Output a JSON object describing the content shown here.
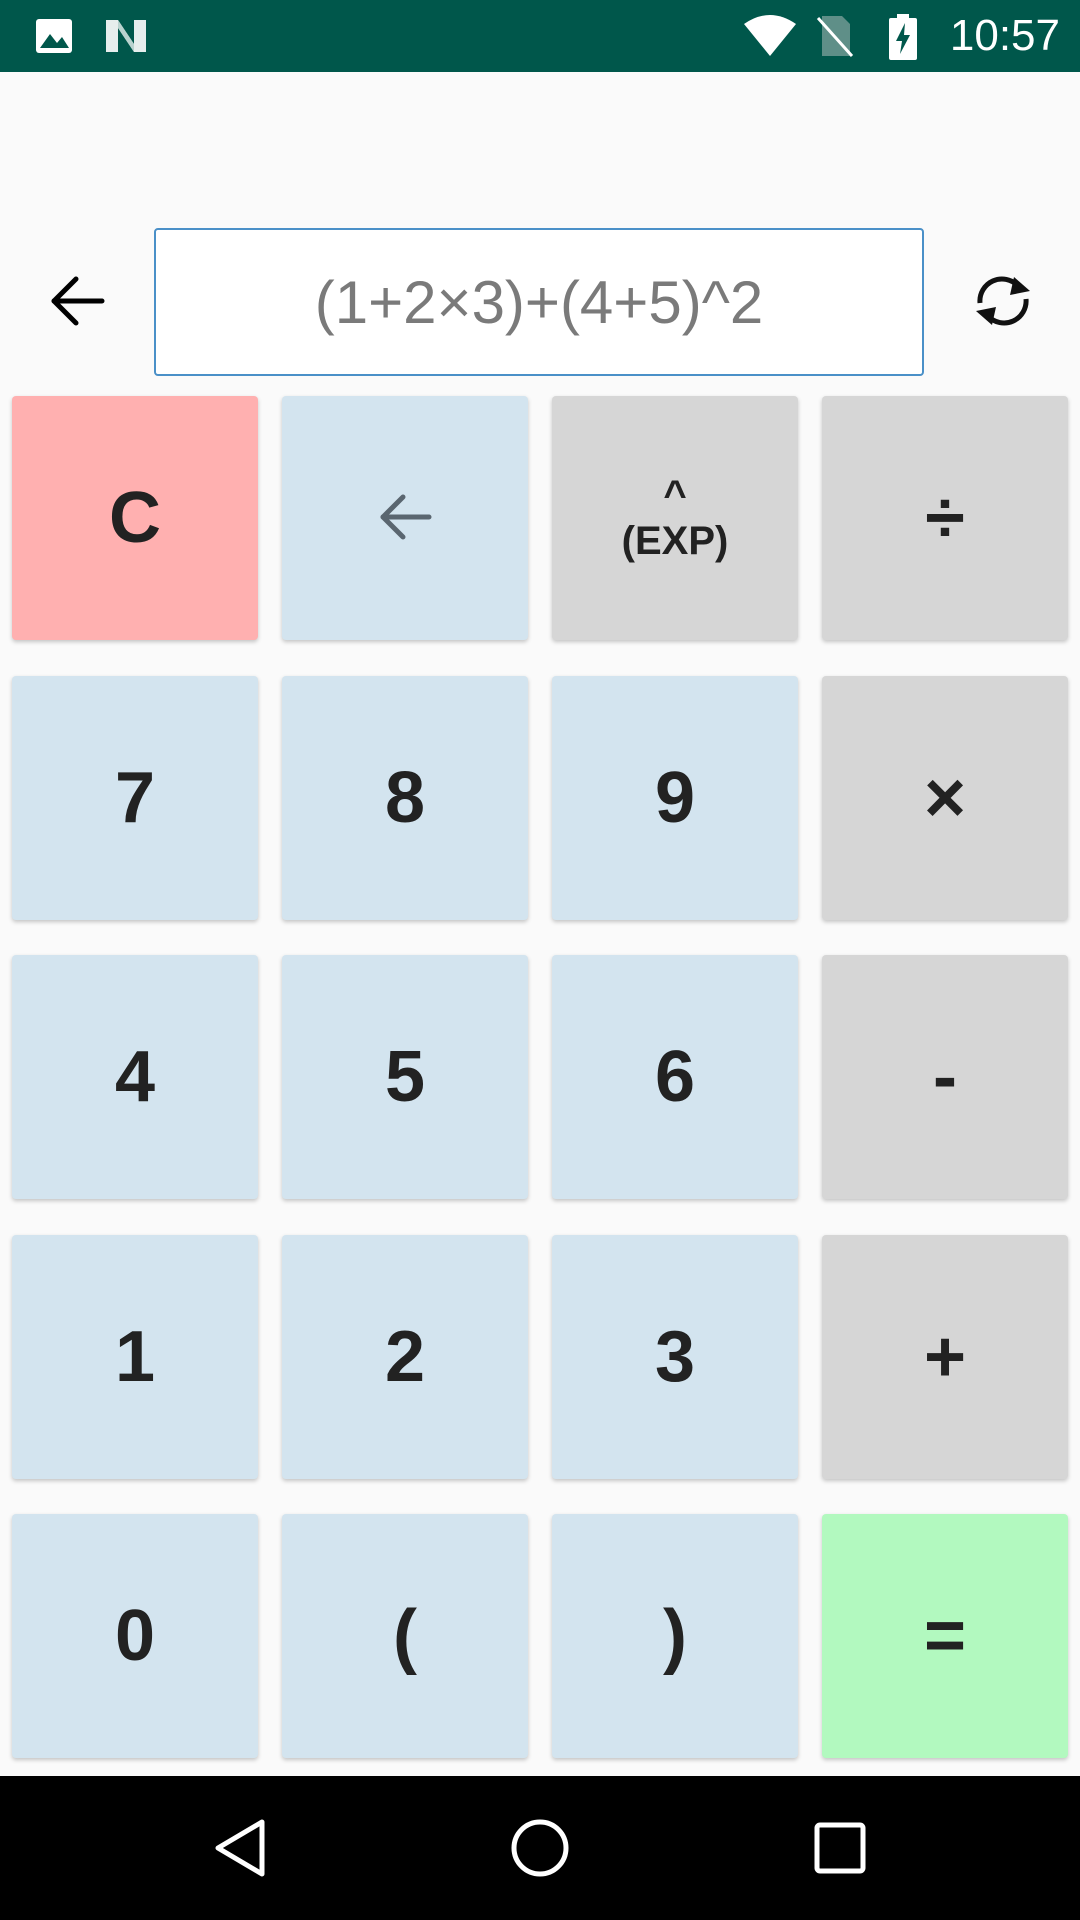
{
  "status_bar": {
    "time": "10:57",
    "icons": [
      "image-icon",
      "n-logo-icon",
      "wifi-icon",
      "no-sim-icon",
      "battery-charging-icon"
    ],
    "background": "#00574b"
  },
  "toolbar": {
    "back_icon": "arrow-left-icon",
    "refresh_icon": "sync-icon"
  },
  "expression": {
    "value": "(1+2×3)+(4+5)^2"
  },
  "keypad": {
    "rows": [
      [
        {
          "label": "C",
          "kind": "clear"
        },
        {
          "label": "",
          "kind": "num",
          "icon": "backspace-arrow-icon"
        },
        {
          "label": "^",
          "sub": "(EXP)",
          "kind": "op"
        },
        {
          "label": "÷",
          "kind": "op"
        }
      ],
      [
        {
          "label": "7",
          "kind": "num"
        },
        {
          "label": "8",
          "kind": "num"
        },
        {
          "label": "9",
          "kind": "num"
        },
        {
          "label": "×",
          "kind": "op"
        }
      ],
      [
        {
          "label": "4",
          "kind": "num"
        },
        {
          "label": "5",
          "kind": "num"
        },
        {
          "label": "6",
          "kind": "num"
        },
        {
          "label": "-",
          "kind": "op"
        }
      ],
      [
        {
          "label": "1",
          "kind": "num"
        },
        {
          "label": "2",
          "kind": "num"
        },
        {
          "label": "3",
          "kind": "num"
        },
        {
          "label": "+",
          "kind": "op"
        }
      ],
      [
        {
          "label": "0",
          "kind": "num"
        },
        {
          "label": "(",
          "kind": "num"
        },
        {
          "label": ")",
          "kind": "num"
        },
        {
          "label": "=",
          "kind": "equals"
        }
      ]
    ],
    "colors": {
      "num": "#d3e4ef",
      "op": "#d6d6d6",
      "clear": "#ffb0b0",
      "equals": "#b2f9bf"
    }
  },
  "nav_bar": {
    "icons": [
      "back-triangle-icon",
      "home-circle-icon",
      "recents-square-icon"
    ]
  }
}
